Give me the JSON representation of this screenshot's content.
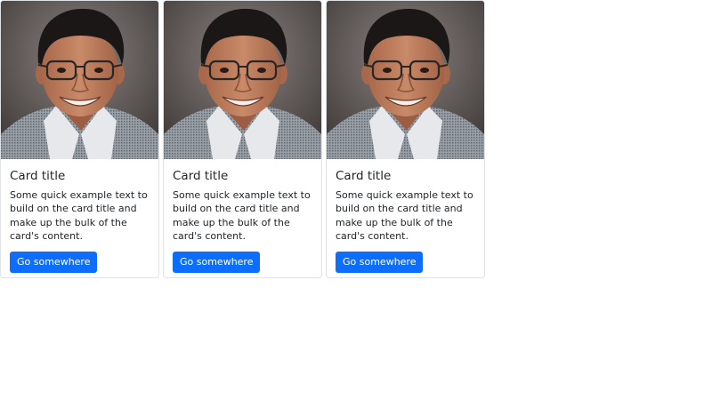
{
  "cards": [
    {
      "image_icon": "person-photo",
      "title": "Card title",
      "text": "Some quick example text to build on the card title and make up the bulk of the card's content.",
      "button_label": "Go somewhere"
    },
    {
      "image_icon": "person-photo",
      "title": "Card title",
      "text": "Some quick example text to build on the card title and make up the bulk of the card's content.",
      "button_label": "Go somewhere"
    },
    {
      "image_icon": "person-photo",
      "title": "Card title",
      "text": "Some quick example text to build on the card title and make up the bulk of the card's content.",
      "button_label": "Go somewhere"
    }
  ],
  "colors": {
    "button_bg": "#0d6efd",
    "button_text": "#ffffff",
    "card_border": "#dfe2e6",
    "text": "#212529"
  }
}
